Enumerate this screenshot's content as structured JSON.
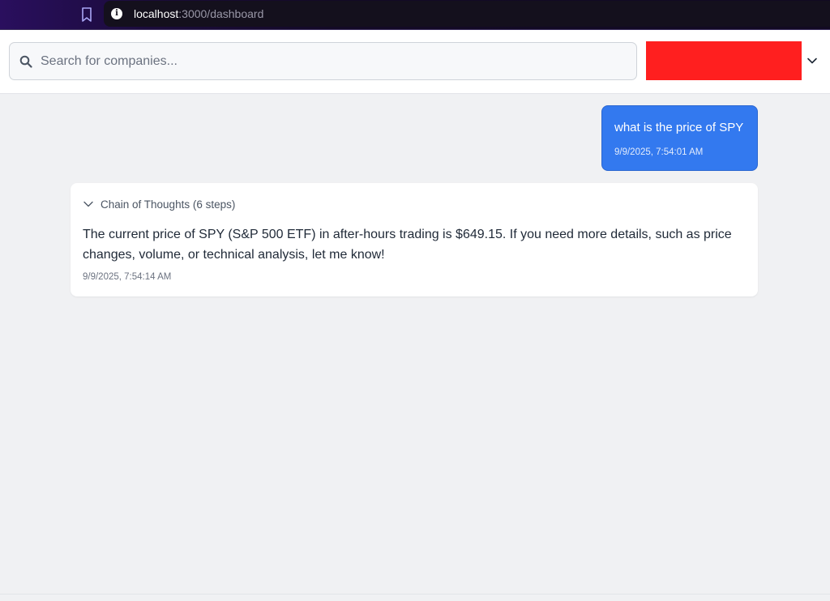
{
  "browser": {
    "url_host": "localhost",
    "url_rest": ":3000/dashboard"
  },
  "header": {
    "search_placeholder": "Search for companies...",
    "search_value": ""
  },
  "colors": {
    "user_bubble": "#3379ef",
    "account_block": "#ff1f1f",
    "page_background": "#f0f1f3"
  },
  "icons": {
    "bookmark": "bookmark-icon",
    "info": "info-icon",
    "search": "search-icon",
    "dropdown": "chevron-down-icon",
    "chain_toggle": "chevron-down-icon"
  },
  "chat": {
    "user_message": {
      "text": "what is the price of SPY",
      "time": "9/9/2025, 7:54:01 AM"
    },
    "assistant_message": {
      "chain_label": "Chain of Thoughts (6 steps)",
      "text": "The current price of SPY (S&P 500 ETF) in after-hours trading is $649.15. If you need more details, such as price changes, volume, or technical analysis, let me know!",
      "time": "9/9/2025, 7:54:14 AM"
    }
  }
}
